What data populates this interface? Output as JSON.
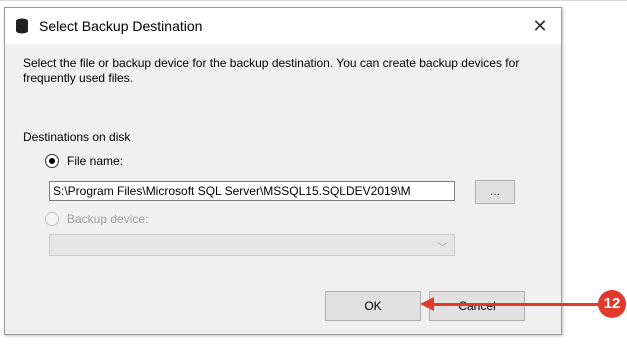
{
  "dialog": {
    "title": "Select Backup Destination",
    "close_glyph": "✕",
    "description": "Select the file or backup device for the backup destination. You can create backup devices for frequently used files.",
    "section_label": "Destinations on disk",
    "file_name_option": {
      "label": "File name:",
      "selected": true
    },
    "file_name_value": "S:\\Program Files\\Microsoft SQL Server\\MSSQL15.SQLDEV2019\\M",
    "browse_label": "...",
    "backup_device_option": {
      "label": "Backup device:",
      "selected": false,
      "enabled": false
    },
    "ok_label": "OK",
    "cancel_label": "Cancel"
  },
  "annotation": {
    "step_number": "12",
    "color": "#e23a2a"
  },
  "icons": {
    "title_icon": "database-icon",
    "dropdown": "chevron-down-icon"
  }
}
